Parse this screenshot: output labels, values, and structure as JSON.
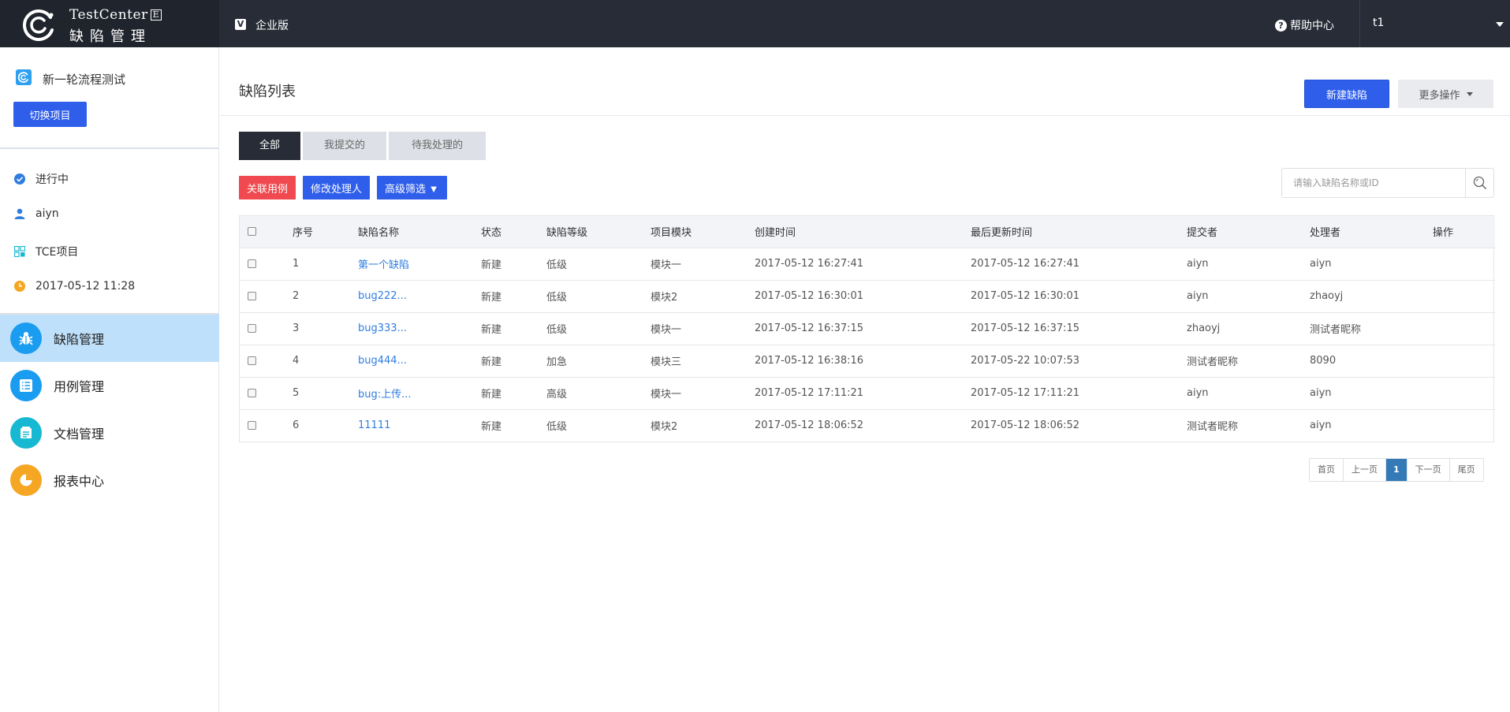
{
  "header": {
    "logo_title": "TestCenter",
    "logo_edition_mark": "E",
    "logo_subtitle": "缺陷管理",
    "edition_badge": "V",
    "edition_label": "企业版",
    "help_icon_glyph": "?",
    "help_label": "帮助中心",
    "user": "t1",
    "bg_color": "#272c37"
  },
  "sidebar": {
    "project_name": "新一轮流程测试",
    "switch_label": "切换项目",
    "info": [
      {
        "icon": "check-circle-icon",
        "text": "进行中"
      },
      {
        "icon": "user-icon",
        "text": "aiyn"
      },
      {
        "icon": "grid-icon",
        "text": "TCE项目"
      },
      {
        "icon": "clock-icon",
        "text": "2017-05-12 11:28"
      }
    ],
    "nav": [
      {
        "icon": "bug-icon",
        "label": "缺陷管理",
        "active": true,
        "color": "#1a9cf0"
      },
      {
        "icon": "list-icon",
        "label": "用例管理",
        "active": false,
        "color": "#1a9cf0"
      },
      {
        "icon": "document-icon",
        "label": "文档管理",
        "active": false,
        "color": "#16b8d2"
      },
      {
        "icon": "pie-chart-icon",
        "label": "报表中心",
        "active": false,
        "color": "#f5a623"
      }
    ]
  },
  "main": {
    "title": "缺陷列表",
    "new_button": "新建缺陷",
    "more_button": "更多操作",
    "tabs": [
      {
        "label": "全部",
        "active": true
      },
      {
        "label": "我提交的",
        "active": false
      },
      {
        "label": "待我处理的",
        "active": false
      }
    ],
    "filters": {
      "link_case": "关联用例",
      "change_handler": "修改处理人",
      "advanced": "高级筛选 ▼"
    },
    "search": {
      "placeholder": "请输入缺陷名称或ID"
    },
    "table": {
      "columns": [
        "序号",
        "缺陷名称",
        "状态",
        "缺陷等级",
        "项目模块",
        "创建时间",
        "最后更新时间",
        "提交者",
        "处理者",
        "操作"
      ],
      "rows": [
        {
          "no": "1",
          "name": "第一个缺陷",
          "status": "新建",
          "level": "低级",
          "module": "模块一",
          "created": "2017-05-12 16:27:41",
          "updated": "2017-05-12 16:27:41",
          "submitter": "aiyn",
          "handler": "aiyn",
          "action": ""
        },
        {
          "no": "2",
          "name": "bug222...",
          "status": "新建",
          "level": "低级",
          "module": "模块2",
          "created": "2017-05-12 16:30:01",
          "updated": "2017-05-12 16:30:01",
          "submitter": "aiyn",
          "handler": "zhaoyj",
          "action": ""
        },
        {
          "no": "3",
          "name": "bug333...",
          "status": "新建",
          "level": "低级",
          "module": "模块一",
          "created": "2017-05-12 16:37:15",
          "updated": "2017-05-12 16:37:15",
          "submitter": "zhaoyj",
          "handler": "测试者昵称",
          "action": ""
        },
        {
          "no": "4",
          "name": "bug444...",
          "status": "新建",
          "level": "加急",
          "module": "模块三",
          "created": "2017-05-12 16:38:16",
          "updated": "2017-05-22 10:07:53",
          "submitter": "测试者昵称",
          "handler": "8090",
          "action": ""
        },
        {
          "no": "5",
          "name": "bug:上传...",
          "status": "新建",
          "level": "高级",
          "module": "模块一",
          "created": "2017-05-12 17:11:21",
          "updated": "2017-05-12 17:11:21",
          "submitter": "aiyn",
          "handler": "aiyn",
          "action": ""
        },
        {
          "no": "6",
          "name": "11111",
          "status": "新建",
          "level": "低级",
          "module": "模块2",
          "created": "2017-05-12 18:06:52",
          "updated": "2017-05-12 18:06:52",
          "submitter": "测试者昵称",
          "handler": "aiyn",
          "action": ""
        }
      ]
    },
    "pagination": {
      "first": "首页",
      "prev": "上一页",
      "current": "1",
      "next": "下一页",
      "last": "尾页"
    }
  }
}
